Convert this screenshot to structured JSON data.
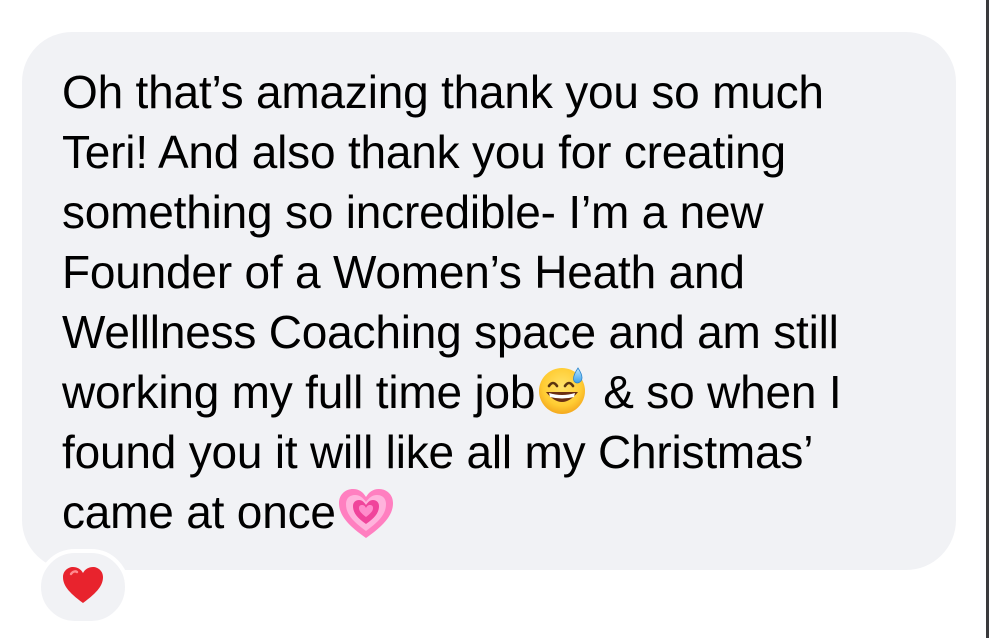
{
  "message": {
    "lines": [
      "Oh that’s amazing thank you so much",
      "Teri! And also thank you for creating",
      "something so incredible- I’m a new",
      "Founder of a Women’s Heath and",
      "Welllness Coaching space and am still",
      "working my full time job",
      "& so when I",
      "found you it will like all my Christmas’",
      "came at once"
    ],
    "emojis": [
      "grinning-sweat-emoji",
      "growing-heart-emoji"
    ]
  },
  "reaction": {
    "icon": "red-heart-icon",
    "color": "#e8232d"
  },
  "colors": {
    "bubble": "#f1f2f5",
    "text": "#000000"
  }
}
